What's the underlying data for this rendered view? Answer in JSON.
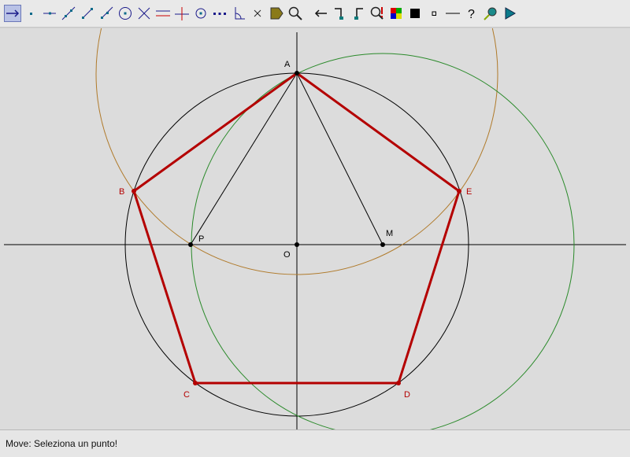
{
  "toolbar": {
    "tools": [
      {
        "name": "move-tool",
        "active": true
      },
      {
        "name": "point-tool"
      },
      {
        "name": "point-on-object-tool"
      },
      {
        "name": "line-tool"
      },
      {
        "name": "segment-tool"
      },
      {
        "name": "ray-tool"
      },
      {
        "name": "circle-tool"
      },
      {
        "name": "intersection-tool"
      },
      {
        "name": "parallel-line-tool"
      },
      {
        "name": "perpendicular-line-tool"
      },
      {
        "name": "center-point-tool"
      },
      {
        "name": "midpoint-tool"
      },
      {
        "name": "angle-tool"
      },
      {
        "name": "delete-tool"
      },
      {
        "name": "label-tool"
      },
      {
        "name": "measure-tool"
      },
      {
        "name": "undo-tool"
      },
      {
        "name": "redo-step-tool"
      },
      {
        "name": "back-step-tool"
      },
      {
        "name": "macro-tool"
      },
      {
        "name": "color-tool"
      },
      {
        "name": "fill-tool"
      },
      {
        "name": "point-style-tool"
      },
      {
        "name": "line-style-tool"
      },
      {
        "name": "help-tool"
      },
      {
        "name": "zoom-tool"
      },
      {
        "name": "play-tool"
      }
    ]
  },
  "colors": {
    "pentagon": "#b40000",
    "construction": "#000000",
    "arc_brown": "#b07a2a",
    "arc_green": "#2a8a2a"
  },
  "points": {
    "A": "A",
    "B": "B",
    "C": "C",
    "D": "D",
    "E": "E",
    "P": "P",
    "M": "M",
    "O": "O"
  },
  "status": {
    "text": "Move: Seleziona un punto!"
  }
}
